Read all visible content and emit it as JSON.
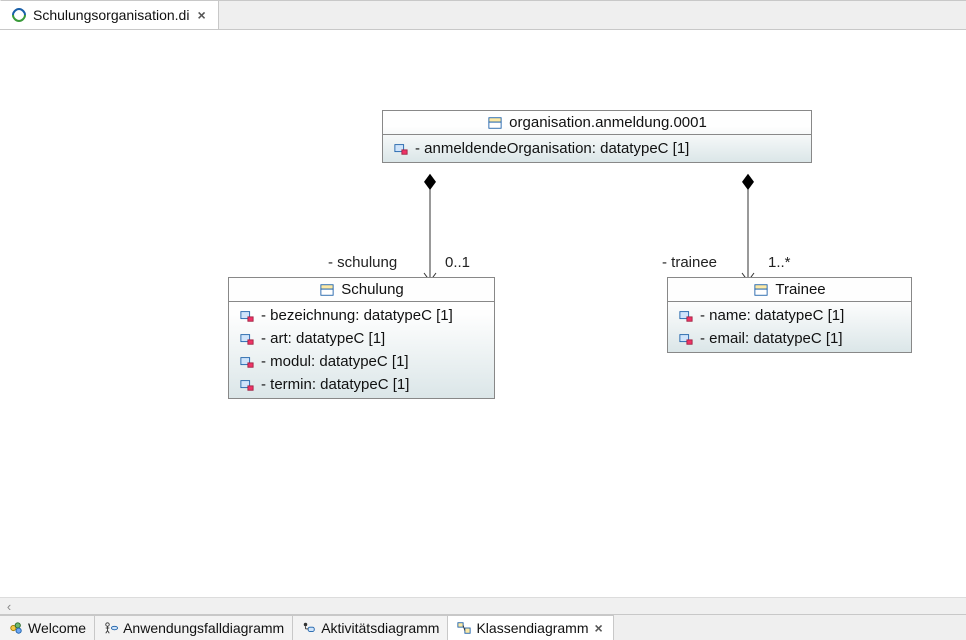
{
  "tabs": {
    "top": {
      "title": "Schulungsorganisation.di"
    }
  },
  "classes": {
    "parent": {
      "name": "organisation.anmeldung.0001",
      "attrs": [
        {
          "text": "- anmeldendeOrganisation: datatypeC [1]"
        }
      ]
    },
    "schulung": {
      "name": "Schulung",
      "attrs": [
        {
          "text": "- bezeichnung: datatypeC [1]"
        },
        {
          "text": "- art: datatypeC [1]"
        },
        {
          "text": "- modul: datatypeC [1]"
        },
        {
          "text": "- termin: datatypeC [1]"
        }
      ]
    },
    "trainee": {
      "name": "Trainee",
      "attrs": [
        {
          "text": "- name: datatypeC [1]"
        },
        {
          "text": "- email: datatypeC [1]"
        }
      ]
    }
  },
  "assoc": {
    "left": {
      "role": "- schulung",
      "mult": "0..1"
    },
    "right": {
      "role": "- trainee",
      "mult": "1..*"
    }
  },
  "bottom_tabs": {
    "welcome": "Welcome",
    "t1": "Anwendungsfalldiagramm",
    "t2": "Aktivitätsdiagramm",
    "t3": "Klassendiagramm"
  },
  "colors": {
    "ruler_blue": "#1a5fa8",
    "accent_green": "#3a9b3a"
  }
}
